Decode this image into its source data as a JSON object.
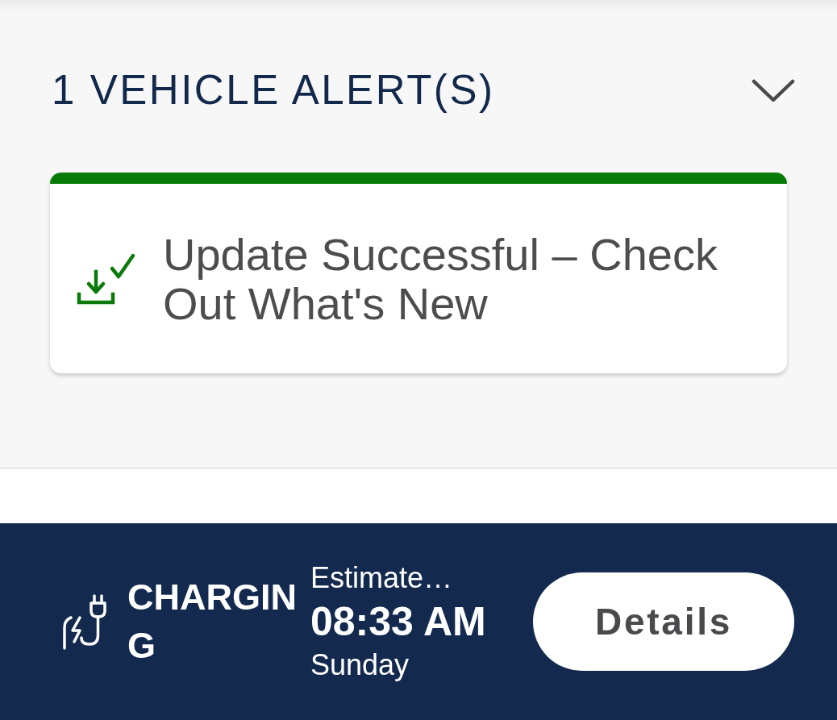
{
  "alerts_header": {
    "title": "1 VEHICLE ALERT(S)"
  },
  "alerts": [
    {
      "kind": "update_success",
      "text": "Update Successful – Check Out What's New"
    }
  ],
  "charging_bar": {
    "status": "CHARGING",
    "estimate_label": "Estimate…",
    "time": "08:33 AM",
    "day": "Sunday",
    "button": "Details"
  }
}
